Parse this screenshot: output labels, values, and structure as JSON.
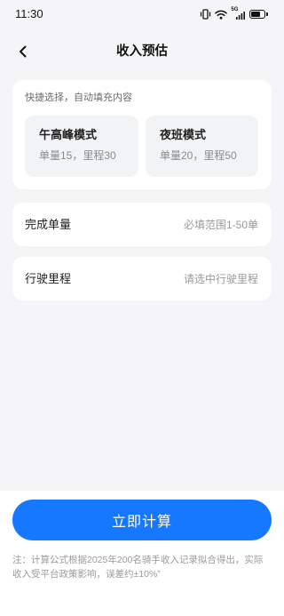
{
  "status_bar": {
    "time": "11:30",
    "network": "5G",
    "battery_level": 0.7,
    "icons": [
      "vibrate-icon",
      "wifi-icon",
      "signal-icon",
      "battery-icon"
    ]
  },
  "header": {
    "title": "收入预估",
    "back_icon": "chevron-left-icon"
  },
  "quick_select": {
    "label": "快捷选择，自动填充内容",
    "options": [
      {
        "title": "午高峰模式",
        "desc": "单量15，里程30"
      },
      {
        "title": "夜班模式",
        "desc": "单量20，里程50"
      }
    ]
  },
  "fields": {
    "orders": {
      "label": "完成单量",
      "placeholder": "必填范围1-50单",
      "value": ""
    },
    "mileage": {
      "label": "行驶里程",
      "placeholder": "请选中行驶里程",
      "value": ""
    }
  },
  "action": {
    "submit_label": "立即计算"
  },
  "note": "注：计算公式根据2025年200名骑手收入记录拟合得出，实际收入受平台政策影响，误差约±10%”",
  "colors": {
    "accent": "#1677ff",
    "background": "#f5f5f7",
    "card": "#ffffff",
    "option_background": "#f2f3f5",
    "placeholder": "#9a9a9a"
  }
}
